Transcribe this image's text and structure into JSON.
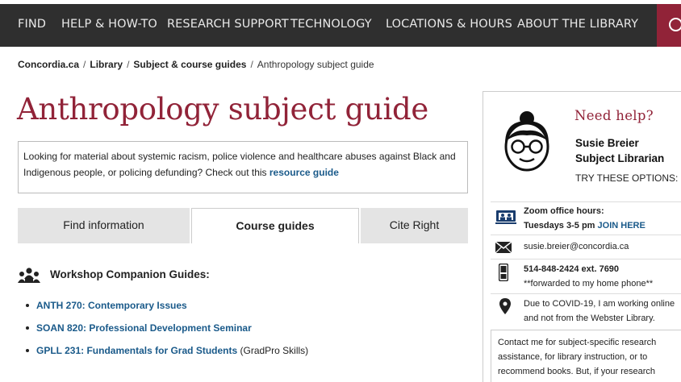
{
  "nav": {
    "items": [
      "FIND",
      "HELP & HOW-TO",
      "RESEARCH SUPPORT",
      "TECHNOLOGY",
      "LOCATIONS & HOURS",
      "ABOUT THE LIBRARY"
    ],
    "search_icon": "search-icon",
    "accent": "#912338"
  },
  "breadcrumb": {
    "items": [
      "Concordia.ca",
      "Library",
      "Subject & course guides"
    ],
    "current": "Anthropology subject guide"
  },
  "page": {
    "title": "Anthropology subject guide",
    "title_color": "#912338"
  },
  "notice": {
    "text": "Looking for material about systemic racism, police violence and healthcare abuses against Black and Indigenous people, or policing defunding? Check out this ",
    "link": "resource guide"
  },
  "tabs": [
    {
      "label": "Find information",
      "active": false
    },
    {
      "label": "Course guides",
      "active": true
    },
    {
      "label": "Cite Right",
      "active": false
    }
  ],
  "workshop": {
    "heading": "Workshop Companion Guides:",
    "icon": "people-group-icon",
    "guides": [
      {
        "link": "ANTH 270: Contemporary Issues",
        "extra": ""
      },
      {
        "link": "SOAN 820: Professional Development Seminar",
        "extra": ""
      },
      {
        "link": "GPLL 231: Fundamentals for Grad Students",
        "extra": " (GradPro Skills)"
      }
    ]
  },
  "sidebar": {
    "heading": "Need help?",
    "name": "Susie Breier",
    "title": "Subject Librarian",
    "try": "TRY THESE OPTIONS:",
    "zoom_label": "Zoom office hours:",
    "zoom_time": "Tuesdays 3-5 pm",
    "zoom_link": "JOIN HERE",
    "email": "susie.breier@concordia.ca",
    "phone": "514-848-2424 ext. 7690",
    "phone_note": "**forwarded to my home phone**",
    "location_line1": "Due to COVID-19, I am working online",
    "location_line2": "and not from the Webster Library.",
    "blurb": "Contact me for subject-specific research assistance, for library instruction, or to recommend books. But, if your research"
  }
}
